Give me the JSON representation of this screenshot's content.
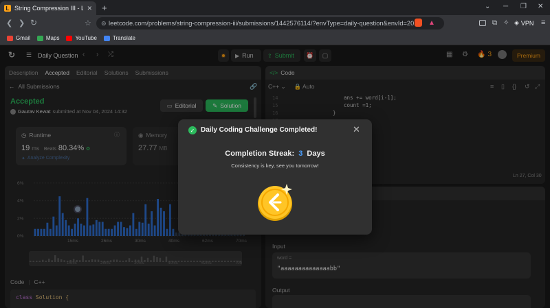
{
  "browser": {
    "tab_title": "String Compression III - LeetCo",
    "new_tab": "+",
    "url": "leetcode.com/problems/string-compression-iii/submissions/1442576114/?envType=daily-question&envId=20...",
    "vpn_label": "VPN",
    "bookmarks": [
      {
        "label": "Gmail",
        "color": "#ea4335"
      },
      {
        "label": "Maps",
        "color": "#34a853"
      },
      {
        "label": "YouTube",
        "color": "#ff0000"
      },
      {
        "label": "Translate",
        "color": "#4285f4"
      }
    ]
  },
  "lc_header": {
    "daily_question": "Daily Question",
    "run": "Run",
    "submit": "Submit",
    "streak_count": "3",
    "premium": "Premium"
  },
  "left_panel": {
    "tabs": [
      "Description",
      "Accepted",
      "Editorial",
      "Solutions",
      "Submissions"
    ],
    "all_submissions": "All Submissions",
    "status": "Accepted",
    "user": "Gaurav Kewat",
    "submitted_at": "submitted at Nov 04, 2024 14:32",
    "editorial_btn": "Editorial",
    "solution_btn": "Solution",
    "runtime_label": "Runtime",
    "runtime_value": "19",
    "runtime_unit": "ms",
    "beats_label": "Beats",
    "beats_value": "80.34%",
    "analyze": "Analyze Complexity",
    "memory_label": "Memory",
    "memory_value": "27.77",
    "memory_unit": "MB",
    "chart_y": [
      "6%",
      "4%",
      "2%",
      "0%"
    ],
    "chart_x": [
      "15ms",
      "26ms",
      "30ms",
      "40ms",
      "62ms",
      "70ms"
    ],
    "code_label": "Code",
    "code_lang": "C++",
    "code_first_line_kw": "class",
    "code_first_line_name": "Solution {"
  },
  "chart_data": {
    "type": "bar",
    "title": "",
    "xlabel": "",
    "ylabel": "",
    "ylim": [
      0,
      7
    ],
    "x_ticks": [
      "15ms",
      "26ms",
      "30ms",
      "40ms",
      "62ms",
      "70ms"
    ],
    "y_ticks": [
      "0%",
      "2%",
      "4%",
      "6%"
    ],
    "values": [
      0.8,
      0.8,
      0.8,
      0.8,
      1.5,
      0.8,
      2.2,
      1.2,
      4.5,
      2.6,
      1.8,
      1.2,
      0.8,
      1.4,
      2.0,
      1.4,
      1.2,
      4.3,
      1.2,
      1.3,
      1.8,
      1.6,
      1.6,
      0.8,
      0.8,
      0.8,
      1.2,
      1.6,
      1.6,
      1.0,
      0.9,
      1.2,
      2.6,
      0.8,
      1.6,
      1.5,
      3.6,
      1.4,
      2.8,
      1.2,
      4.2,
      3.2,
      2.8,
      0.8,
      3.6,
      0.8,
      0.4,
      0.4,
      0.3,
      0.3,
      0.3,
      0.3,
      0.3,
      0.3,
      0.3,
      0.3,
      0.3,
      0.3,
      0.3,
      0.3,
      0.3,
      0.3,
      0.3,
      0.3,
      0.3,
      0.3,
      0.3,
      0.3,
      0.3
    ]
  },
  "right_panel": {
    "title": "Code",
    "lang": "C++",
    "auto": "Auto",
    "lines": [
      {
        "n": "14",
        "text": "ans += word[i-1];"
      },
      {
        "n": "15",
        "text": "count =1;"
      },
      {
        "n": "16",
        "text": "}"
      },
      {
        "n": "17",
        "text": ""
      }
    ],
    "cursor": "Ln 27, Col 30",
    "input_label": "Input",
    "word_label": "word =",
    "input_value": "\"aaaaaaaaaaaaaabb\"",
    "output_label": "Output"
  },
  "modal": {
    "title": "Daily Coding Challenge Completed!",
    "streak_label": "Completion Streak:",
    "streak_value": "3",
    "streak_unit": "Days",
    "message": "Consistency is key, see you tomorrow!"
  }
}
